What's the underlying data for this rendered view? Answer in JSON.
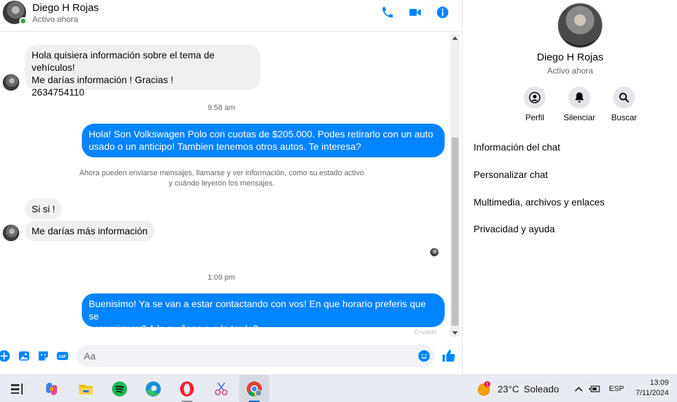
{
  "header": {
    "name": "Diego H Rojas",
    "status": "Activo ahora"
  },
  "messages": {
    "first": {
      "line1": "Hola quisiera información sobre el tema de vehículos!",
      "line2": "Me darías información ! Gracias !",
      "line3": "2634754110"
    },
    "time1": "9:58 am",
    "reply1": {
      "line1": "Hola! Son Volkswagen Polo con cuotas de $205.000. Podes retirarlo con un auto",
      "line2": "usado o un anticipo! Tambien tenemos otros autos. Te interesa?"
    },
    "system": {
      "line1": "Ahora pueden enviarse mensajes, llamarse y ver información, como su estado activo",
      "line2": "y cuándo leyeron los mensajes."
    },
    "in2": "Si si !",
    "in3": "Me darías más información",
    "time2": "1:09 pm",
    "reply2": {
      "line1": "Buenisimo! Ya se van a estar contactando con vos! En que horario preferis que se",
      "line2": "comuniquen? A la mañana o a la tarde?"
    },
    "sent_label": "Enviado"
  },
  "composer": {
    "placeholder": "Aa",
    "gif_label": "GIF"
  },
  "panel": {
    "name": "Diego H Rojas",
    "status": "Activo ahora",
    "actions": [
      {
        "label": "Perfil",
        "icon": "profile-icon"
      },
      {
        "label": "Silenciar",
        "icon": "bell-icon"
      },
      {
        "label": "Buscar",
        "icon": "search-icon"
      }
    ],
    "menu": [
      "Información del chat",
      "Personalizar chat",
      "Multimedia, archivos y enlaces",
      "Privacidad y ayuda"
    ]
  },
  "taskbar": {
    "weather_badge": "1",
    "temperature": "23°C",
    "condition": "Soleado",
    "language": "ESP",
    "time": "13:09",
    "date": "7/11/2024"
  },
  "colors": {
    "accent": "#0084ff",
    "incoming_bubble": "#f0f0f0",
    "online": "#31a24c"
  }
}
